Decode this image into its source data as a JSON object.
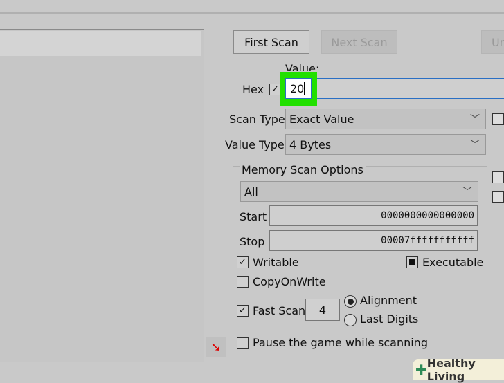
{
  "toolbar": {
    "first_scan": "First Scan",
    "next_scan": "Next Scan",
    "undo_scan": "Un"
  },
  "value": {
    "label": "Value:",
    "hex_label": "Hex",
    "hex_checked": true,
    "input": "20",
    "highlight_color": "#22e000"
  },
  "scan_type": {
    "label": "Scan Type",
    "selected": "Exact Value"
  },
  "value_type": {
    "label": "Value Type",
    "selected": "4 Bytes"
  },
  "memory": {
    "title": "Memory Scan Options",
    "region": "All",
    "start_label": "Start",
    "start": "0000000000000000",
    "stop_label": "Stop",
    "stop": "00007fffffffffff",
    "writable": "Writable",
    "executable": "Executable",
    "copy_on_write": "CopyOnWrite",
    "fast_scan": "Fast Scan",
    "fast_scan_value": "4",
    "alignment": "Alignment",
    "last_digits": "Last Digits",
    "pause": "Pause the game while scanning"
  },
  "watermark": "Healthy Living",
  "watermark_colors": {
    "cross": "#2e8b57"
  }
}
